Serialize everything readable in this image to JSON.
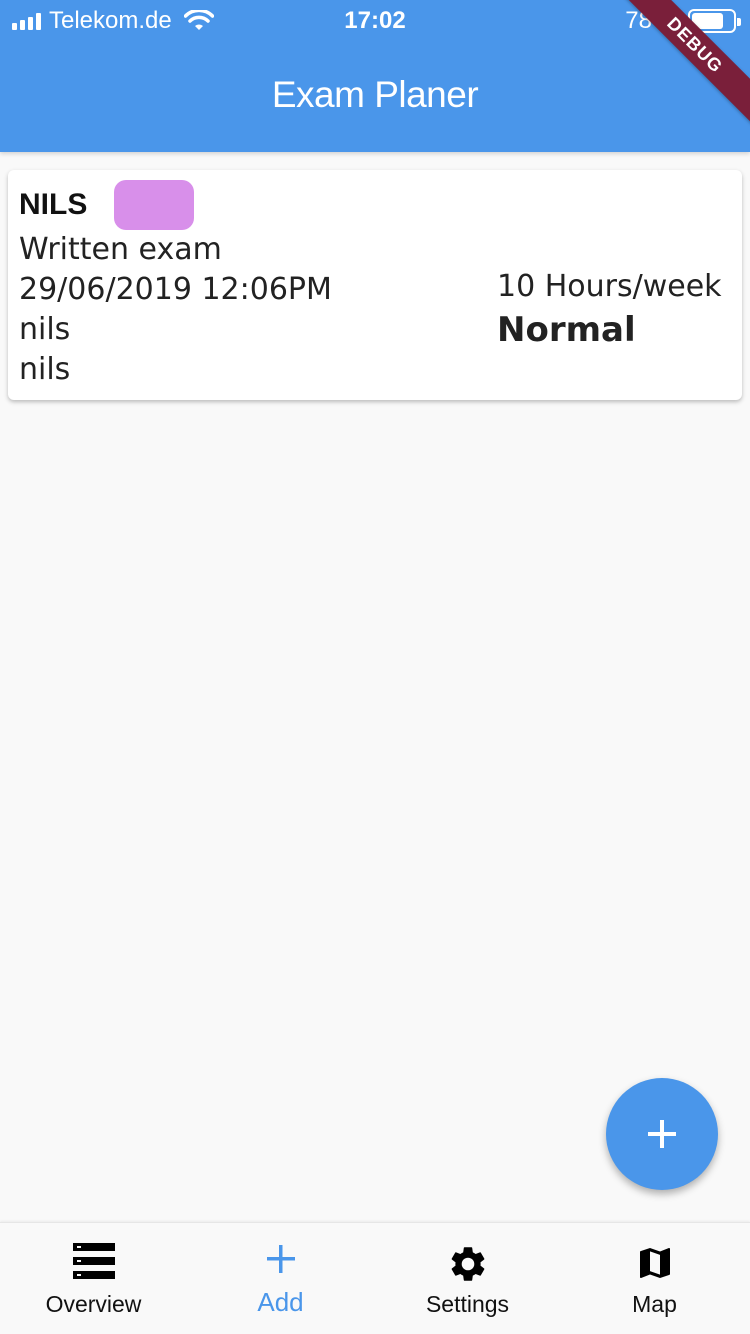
{
  "status_bar": {
    "carrier": "Telekom.de",
    "time": "17:02",
    "battery_percent": "78 %",
    "battery_level": 0.78
  },
  "app_bar": {
    "title": "Exam Planer"
  },
  "debug_banner": "DEBUG",
  "exams": [
    {
      "name": "NILS",
      "color": "#d88fea",
      "type": "Written exam",
      "datetime": "29/06/2019 12:06PM",
      "line3": "nils",
      "line4": "nils",
      "hours": "10 Hours/week",
      "priority": "Normal"
    }
  ],
  "fab": {
    "icon": "plus-icon"
  },
  "bottom_nav": {
    "items": [
      {
        "label": "Overview",
        "icon": "list-icon",
        "active": false
      },
      {
        "label": "Add",
        "icon": "plus-icon",
        "active": true
      },
      {
        "label": "Settings",
        "icon": "gear-icon",
        "active": false
      },
      {
        "label": "Map",
        "icon": "map-icon",
        "active": false
      }
    ]
  },
  "colors": {
    "primary": "#4a96ea",
    "background": "#f9f9f9",
    "ribbon": "#7a1f3a"
  }
}
